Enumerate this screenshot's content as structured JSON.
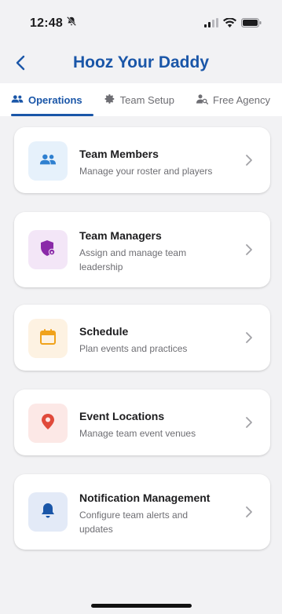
{
  "status_bar": {
    "time": "12:48",
    "icons": [
      "bell-slash-icon",
      "cellular-signal-icon",
      "wifi-icon",
      "battery-icon"
    ]
  },
  "header": {
    "title": "Hooz Your Daddy",
    "back_icon": "chevron-left-icon"
  },
  "tabs": [
    {
      "label": "Operations",
      "icon": "people-icon",
      "active": true
    },
    {
      "label": "Team Setup",
      "icon": "gear-icon",
      "active": false
    },
    {
      "label": "Free Agency",
      "icon": "person-search-icon",
      "active": false
    }
  ],
  "cards": [
    {
      "title": "Team Members",
      "subtitle": "Manage your roster and players",
      "icon": "people-icon",
      "icon_color": "#2f80d0",
      "icon_bg": "#e6f1fb"
    },
    {
      "title": "Team Managers",
      "subtitle": "Assign and manage team leadership",
      "icon": "shield-lock-icon",
      "icon_color": "#8a2aa8",
      "icon_bg": "#f3e6f7"
    },
    {
      "title": "Schedule",
      "subtitle": "Plan events and practices",
      "icon": "calendar-icon",
      "icon_color": "#f0a21b",
      "icon_bg": "#fdf2e2"
    },
    {
      "title": "Event Locations",
      "subtitle": "Manage team event venues",
      "icon": "location-pin-icon",
      "icon_color": "#e04a3b",
      "icon_bg": "#fce8e6"
    },
    {
      "title": "Notification Management",
      "subtitle": "Configure team alerts and updates",
      "icon": "bell-icon",
      "icon_color": "#1a56a8",
      "icon_bg": "#e3eaf7"
    }
  ],
  "colors": {
    "accent": "#1a56a8",
    "background": "#f2f2f4"
  }
}
